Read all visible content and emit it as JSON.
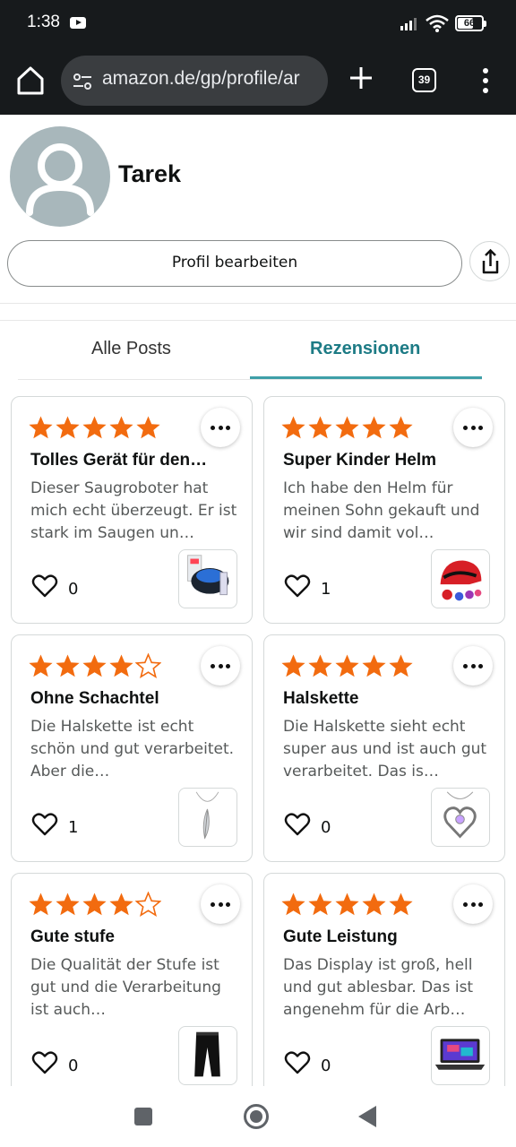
{
  "status_bar": {
    "time": "1:38",
    "battery": "66"
  },
  "browser": {
    "url": "amazon.de/gp/profile/ar",
    "tab_count": "39"
  },
  "profile": {
    "name": "Tarek",
    "edit_label": "Profil bearbeiten"
  },
  "tabs": {
    "all_posts": "Alle Posts",
    "reviews": "Rezensionen",
    "active": "reviews"
  },
  "reviews": [
    {
      "rating": 5,
      "title": "Tolles Gerät für den…",
      "body": "Dieser Saugroboter hat mich echt überzeugt. Er ist stark im Saugen un…",
      "likes": "0",
      "product_icon": "robot-vacuum"
    },
    {
      "rating": 5,
      "title": "Super Kinder Helm",
      "body": "Ich habe den Helm für meinen Sohn gekauft und wir sind damit vol…",
      "likes": "1",
      "product_icon": "kids-helmet"
    },
    {
      "rating": 4,
      "title": "Ohne Schachtel",
      "body": "Die Halskette ist echt schön und gut verarbeitet. Aber die…",
      "likes": "1",
      "product_icon": "feather-necklace"
    },
    {
      "rating": 5,
      "title": "Halskette",
      "body": "Die Halskette sieht echt super aus und ist auch gut verarbeitet. Das is…",
      "likes": "0",
      "product_icon": "heart-necklace"
    },
    {
      "rating": 4,
      "title": "Gute stufe",
      "body": "Die Qualität der Stufe ist gut und die Verarbeitung ist auch…",
      "likes": "0",
      "product_icon": "black-pants"
    },
    {
      "rating": 5,
      "title": "Gute Leistung",
      "body": "Das Display ist groß, hell und gut ablesbar. Das ist angenehm für die Arb…",
      "likes": "0",
      "product_icon": "laptop"
    }
  ],
  "colors": {
    "star": "#f26b0f",
    "active_tab": "#1d7b85",
    "underline": "#3f9fa8"
  }
}
